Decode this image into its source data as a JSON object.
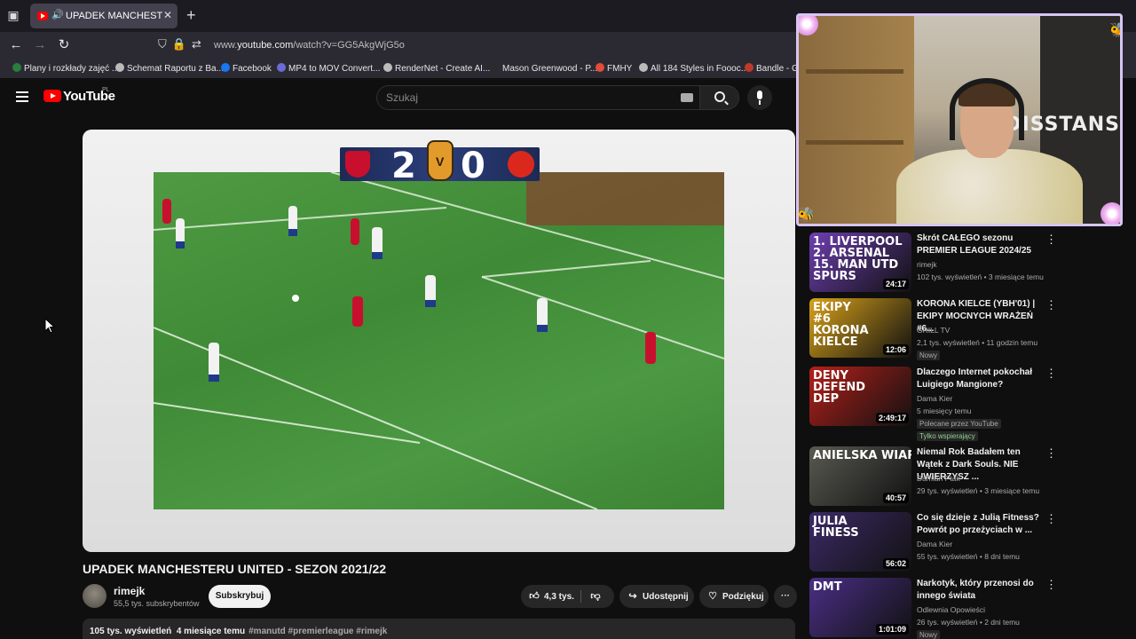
{
  "browser": {
    "tab_title": "UPADEK MANCHESTERU UNITED",
    "url_prefix": "www.",
    "url_domain": "youtube.com",
    "url_path": "/watch?v=GG5AkgWjG5o",
    "bookmarks": [
      {
        "label": "Plany i rozkłady zajęć ...",
        "color": "#2a7d3f"
      },
      {
        "label": "Schemat Raportu z Ba...",
        "color": "#bbbbbb"
      },
      {
        "label": "Facebook",
        "color": "#1877f2"
      },
      {
        "label": "MP4 to MOV Convert...",
        "color": "#6b6bd6"
      },
      {
        "label": "RenderNet - Create AI...",
        "color": "#bbbbbb"
      },
      {
        "label": "Mason Greenwood - P...",
        "color": "#2b2b2b"
      },
      {
        "label": "FMHY",
        "color": "#e24c3a"
      },
      {
        "label": "All 184 Styles in Foooc...",
        "color": "#bbbbbb"
      },
      {
        "label": "Bandle - G",
        "color": "#c0392b"
      }
    ]
  },
  "youtube": {
    "logo_text": "YouTube",
    "country_code": "PL",
    "search_placeholder": "Szukaj"
  },
  "video": {
    "scoreboard": {
      "home": "2",
      "away": "0"
    },
    "title": "UPADEK MANCHESTERU UNITED - SEZON 2021/22",
    "channel": "rimejk",
    "subscribers": "55,5 tys. subskrybentów",
    "subscribe_label": "Subskrybuj",
    "likes": "4,3 tys.",
    "share_label": "Udostępnij",
    "thanks_label": "Podziękuj",
    "views": "105 tys. wyświetleń",
    "age": "4 miesiące temu",
    "hashtags": "#manutd #premierleague #rimejk"
  },
  "webcam": {
    "sign_text": "DISSTANS"
  },
  "recommendations": [
    {
      "title": "Skrót CAŁEGO sezonu PREMIER LEAGUE 2024/25",
      "channel": "rimejk",
      "meta": "102 tys. wyświetleń • 3 miesiące temu",
      "duration": "24:17",
      "thumb_text": "1. LIVERPOOL\n2. ARSENAL\n15. MAN UTD\nSPURS",
      "thumb_color": "#6d3fb0",
      "badges": []
    },
    {
      "title": "KORONA KIELCE (YBH'01) | EKIPY MOCNYCH WRAŻEŃ #6...",
      "channel": "GRILL TV",
      "meta": "2,1 tys. wyświetleń • 11 godzin temu",
      "duration": "12:06",
      "thumb_text": "EKIPY\n#6\nKORONA\nKIELCE",
      "thumb_color": "#d8a21a",
      "badges": [
        "Nowy"
      ]
    },
    {
      "title": "Dlaczego Internet pokochał Luigiego Mangione?",
      "channel": "Dama Kier",
      "meta": "5 miesięcy temu",
      "duration": "2:49:17",
      "thumb_text": "DENY\nDEFEND\nDEP",
      "thumb_color": "#b4201a",
      "badges": [
        "Polecane przez YouTube",
        "Tylko wspierający"
      ]
    },
    {
      "title": "Niemal Rok Badałem ten Wątek z Dark Souls. NIE UWIERZYSZ ...",
      "channel": "Damian Ptak",
      "meta": "29 tys. wyświetleń • 3 miesiące temu",
      "duration": "40:57",
      "thumb_text": "ANIELSKA WIARA",
      "thumb_color": "#5a5a52",
      "badges": []
    },
    {
      "title": "Co się dzieje z Julią Fitness? Powrót po przeżyciach w ...",
      "channel": "Dama Kier",
      "meta": "55 tys. wyświetleń • 8 dni temu",
      "duration": "56:02",
      "thumb_text": "JULIA\nFINESS",
      "thumb_color": "#3c2a66",
      "badges": []
    },
    {
      "title": "Narkotyk, który przenosi do innego świata",
      "channel": "Odlewnia Opowieści",
      "meta": "26 tys. wyświetleń • 2 dni temu",
      "duration": "1:01:09",
      "thumb_text": "DMT",
      "thumb_color": "#4a2f86",
      "badges": [
        "Nowy"
      ]
    }
  ]
}
